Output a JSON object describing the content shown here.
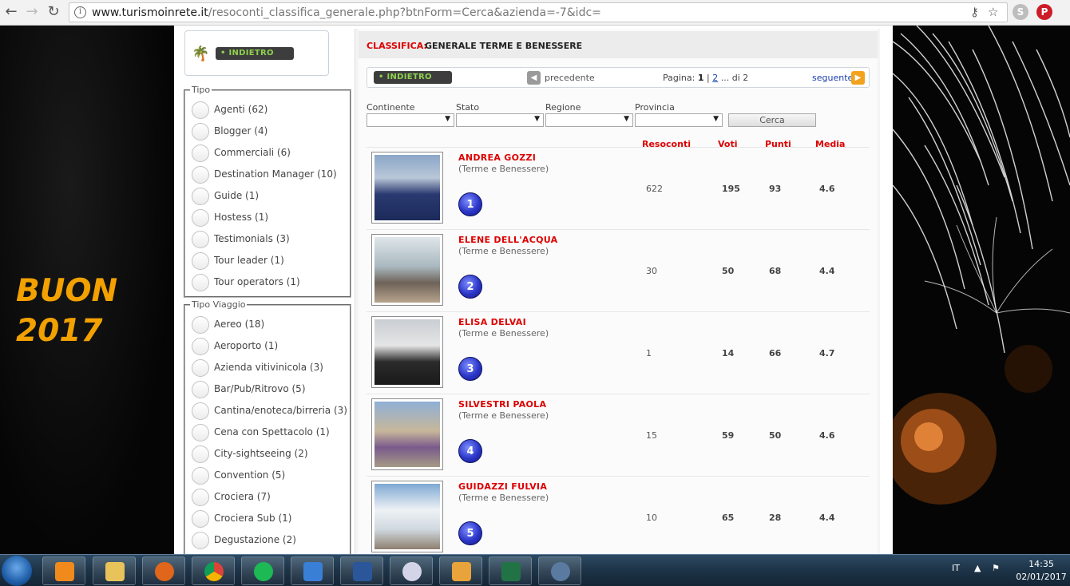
{
  "browser": {
    "url_host": "www.turismoinrete.it",
    "url_path": "/resoconti_classifica_generale.php?btnForm=Cerca&azienda=-7&idc="
  },
  "banner": {
    "line1": "BUON",
    "line2": "2017"
  },
  "sidebar": {
    "back_label": "• INDIETRO",
    "tipo": {
      "legend": "Tipo",
      "items": [
        "Agenti (62)",
        "Blogger (4)",
        "Commerciali (6)",
        "Destination Manager (10)",
        "Guide (1)",
        "Hostess (1)",
        "Testimonials (3)",
        "Tour leader (1)",
        "Tour operators (1)"
      ]
    },
    "tipo_viaggio": {
      "legend": "Tipo Viaggio",
      "items": [
        "Aereo (18)",
        "Aeroporto (1)",
        "Azienda vitivinicola (3)",
        "Bar/Pub/Ritrovo (5)",
        "Cantina/enoteca/birreria (3)",
        "Cena con Spettacolo (1)",
        "City-sightseeing (2)",
        "Convention (5)",
        "Crociera (7)",
        "Crociera Sub (1)",
        "Degustazione (2)"
      ]
    }
  },
  "main": {
    "title_prefix": "CLASSIFICA:",
    "title": "GENERALE TERME E BENESSERE",
    "back_label": "• INDIETRO",
    "pager": {
      "prev": "precedente",
      "page_label": "Pagina:",
      "current": "1",
      "sep": "|",
      "page2": "2",
      "suffix": "... di 2",
      "next": "seguente"
    },
    "filters": {
      "continente": "Continente",
      "stato": "Stato",
      "regione": "Regione",
      "provincia": "Provincia",
      "button": "Cerca"
    },
    "columns": {
      "resoconti": "Resoconti",
      "voti": "Voti",
      "punti": "Punti",
      "media": "Media"
    },
    "rows": [
      {
        "name": "ANDREA GOZZI",
        "cat": "(Terme e Benessere)",
        "rank": "1",
        "resoconti": "622",
        "voti": "195",
        "punti": "93",
        "media": "4.6"
      },
      {
        "name": "ELENE DELL'ACQUA",
        "cat": "(Terme e Benessere)",
        "rank": "2",
        "resoconti": "30",
        "voti": "50",
        "punti": "68",
        "media": "4.4"
      },
      {
        "name": "ELISA DELVAI",
        "cat": "(Terme e Benessere)",
        "rank": "3",
        "resoconti": "1",
        "voti": "14",
        "punti": "66",
        "media": "4.7"
      },
      {
        "name": "SILVESTRI PAOLA",
        "cat": "(Terme e Benessere)",
        "rank": "4",
        "resoconti": "15",
        "voti": "59",
        "punti": "50",
        "media": "4.6"
      },
      {
        "name": "GUIDAZZI FULVIA",
        "cat": "(Terme e Benessere)",
        "rank": "5",
        "resoconti": "10",
        "voti": "65",
        "punti": "28",
        "media": "4.4"
      }
    ]
  },
  "taskbar": {
    "lang": "IT",
    "time": "14:35",
    "date": "02/01/2017"
  },
  "colors": {
    "accent_red": "#dd0000",
    "banner_orange": "#f2a100",
    "rank_blue": "#2b36c8"
  }
}
